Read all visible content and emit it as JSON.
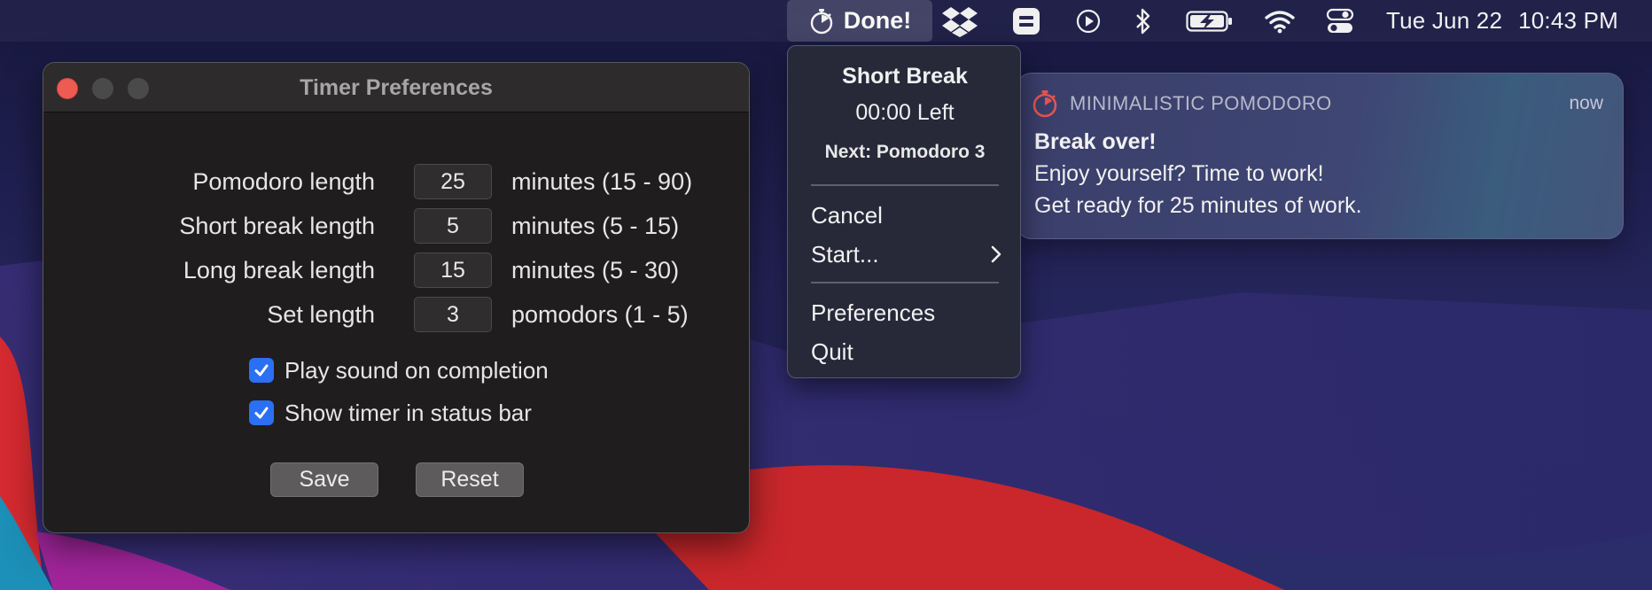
{
  "menubar": {
    "timer_label": "Done!",
    "clock_date": "Tue Jun 22",
    "clock_time": "10:43 PM"
  },
  "window": {
    "title": "Timer Preferences",
    "fields": [
      {
        "label": "Pomodoro length",
        "value": "25",
        "hint": "minutes (15 - 90)"
      },
      {
        "label": "Short break length",
        "value": "5",
        "hint": "minutes (5 - 15)"
      },
      {
        "label": "Long break length",
        "value": "15",
        "hint": "minutes (5 - 30)"
      },
      {
        "label": "Set length",
        "value": "3",
        "hint": "pomodors (1 - 5)"
      }
    ],
    "checkboxes": [
      {
        "label": "Play sound on completion",
        "checked": true
      },
      {
        "label": "Show timer in status bar",
        "checked": true
      }
    ],
    "save_label": "Save",
    "reset_label": "Reset"
  },
  "menu": {
    "title": "Short Break",
    "time_left": "00:00 Left",
    "next": "Next: Pomodoro 3",
    "items": [
      {
        "label": "Cancel"
      },
      {
        "label": "Start...",
        "submenu": true
      },
      {
        "label": "Preferences"
      },
      {
        "label": "Quit"
      }
    ]
  },
  "notification": {
    "app_name": "MINIMALISTIC POMODORO",
    "time": "now",
    "title": "Break over!",
    "body_line1": "Enjoy yourself? Time to work!",
    "body_line2": "Get ready for 25 minutes of work."
  },
  "icons": {
    "timer": "stopwatch-icon",
    "dropbox": "dropbox-icon",
    "app": "equals-square-icon",
    "media": "play-circle-icon",
    "bluetooth": "bluetooth-icon",
    "battery": "battery-charging-icon",
    "wifi": "wifi-icon",
    "control_center": "control-center-icon",
    "checkmark": "checkmark-icon",
    "chevron": "chevron-right-icon"
  },
  "colors": {
    "checkbox_accent": "#2b6ff3",
    "close_button": "#ee5b52",
    "app_icon_accent": "#e4564b"
  }
}
